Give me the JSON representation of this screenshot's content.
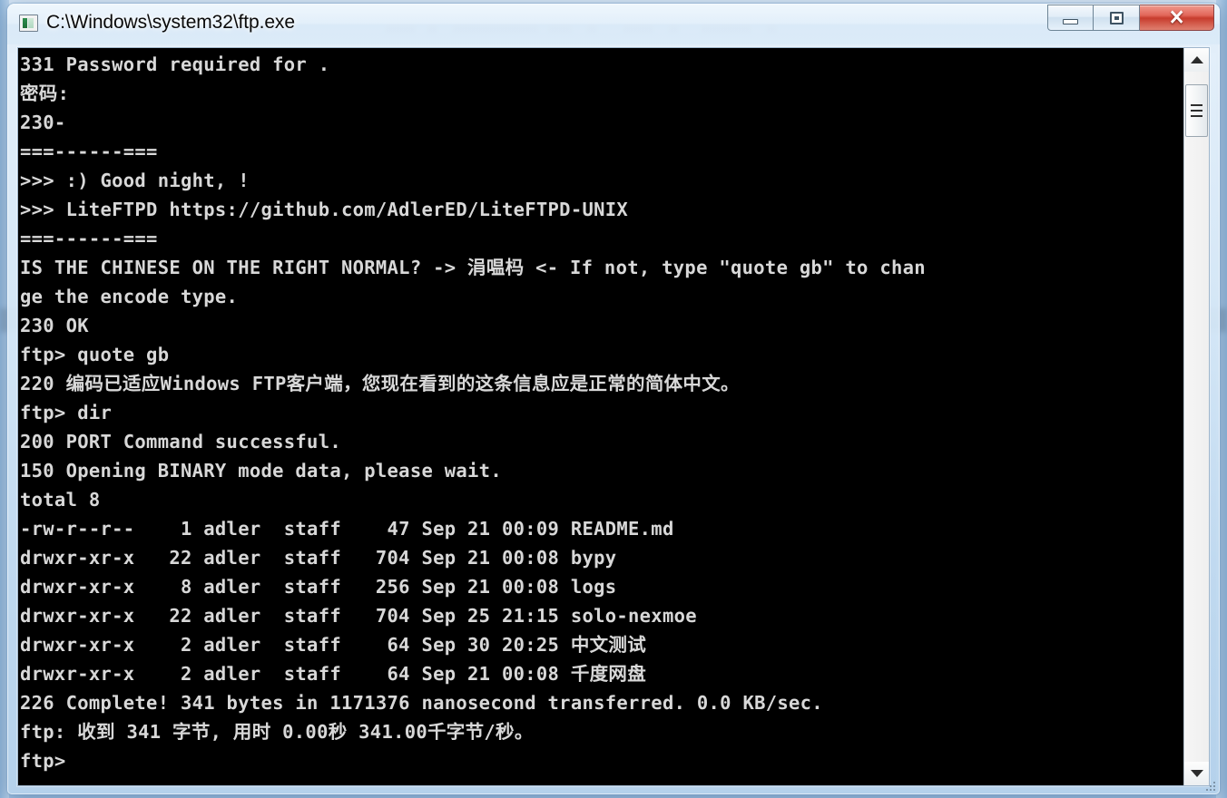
{
  "window": {
    "title": "C:\\Windows\\system32\\ftp.exe",
    "app_icon": "console-app-icon",
    "buttons": {
      "minimize": "minimize-button",
      "maximize": "maximize-restore-button",
      "close_label": "✕"
    }
  },
  "colors": {
    "console_background": "#000000",
    "console_text": "#d8d8d8",
    "titlebar_glass": "#dceaf7",
    "close_button": "#c73c2d"
  },
  "console": {
    "lines": [
      "331 Password required for .",
      "密码:",
      "230-",
      "===------===",
      ">>> :) Good night, !",
      ">>> LiteFTPD https://github.com/AdlerED/LiteFTPD-UNIX",
      "===------===",
      "IS THE CHINESE ON THE RIGHT NORMAL? -> 涓嗢杩 <- If not, type \"quote gb\" to chan",
      "ge the encode type.",
      "230 OK",
      "ftp> quote gb",
      "220 编码已适应Windows FTP客户端，您现在看到的这条信息应是正常的简体中文。",
      "ftp> dir",
      "200 PORT Command successful.",
      "150 Opening BINARY mode data, please wait.",
      "total 8",
      "-rw-r--r--    1 adler  staff    47 Sep 21 00:09 README.md",
      "drwxr-xr-x   22 adler  staff   704 Sep 21 00:08 bypy",
      "drwxr-xr-x    8 adler  staff   256 Sep 21 00:08 logs",
      "drwxr-xr-x   22 adler  staff   704 Sep 25 21:15 solo-nexmoe",
      "drwxr-xr-x    2 adler  staff    64 Sep 30 20:25 中文测试",
      "drwxr-xr-x    2 adler  staff    64 Sep 21 00:08 千度网盘",
      "226 Complete! 341 bytes in 1171376 nanosecond transferred. 0.0 KB/sec.",
      "ftp: 收到 341 字节, 用时 0.00秒 341.00千字节/秒。",
      "ftp>"
    ]
  },
  "scrollbar": {
    "up_arrow": "▲",
    "down_arrow": "▼",
    "thumb": "scrollbar-thumb"
  }
}
